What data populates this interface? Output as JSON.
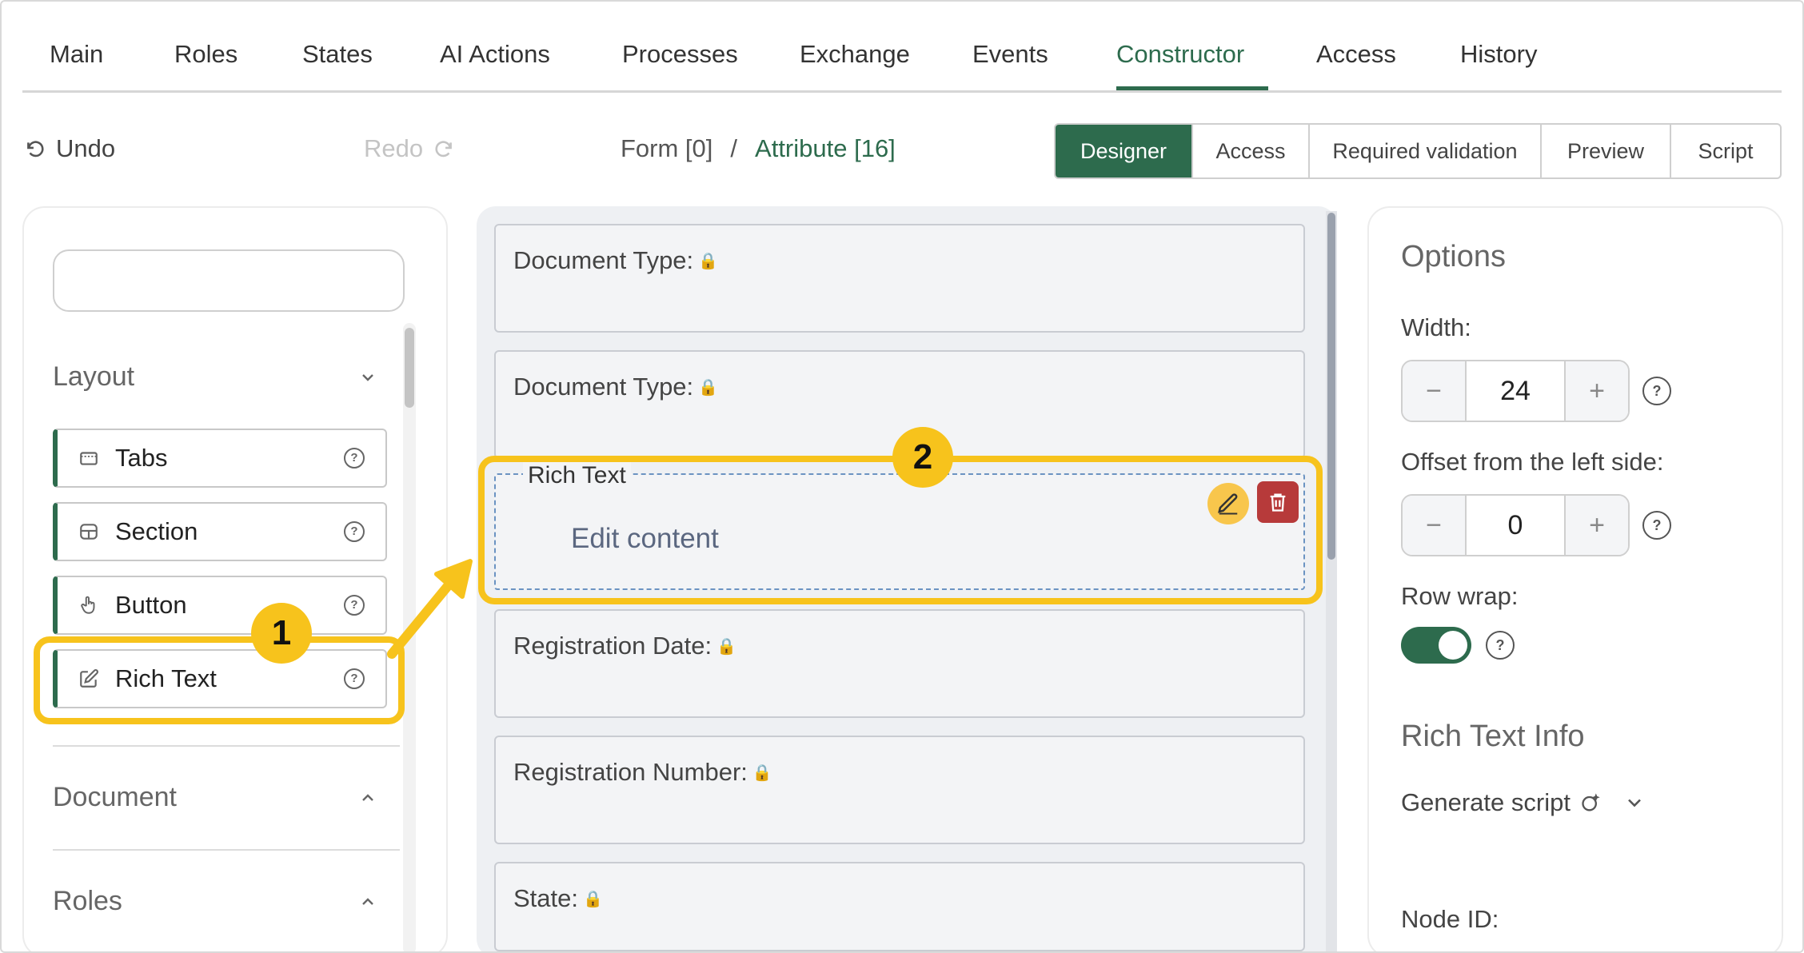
{
  "top_tabs": [
    {
      "label": "Main"
    },
    {
      "label": "Roles"
    },
    {
      "label": "States"
    },
    {
      "label": "AI Actions"
    },
    {
      "label": "Processes"
    },
    {
      "label": "Exchange"
    },
    {
      "label": "Events"
    },
    {
      "label": "Constructor",
      "active": true
    },
    {
      "label": "Access"
    },
    {
      "label": "History"
    }
  ],
  "toolbar": {
    "undo_label": "Undo",
    "redo_label": "Redo",
    "breadcrumb": {
      "form": "Form [0]",
      "separator": "/",
      "attribute": "Attribute [16]"
    },
    "modes": [
      "Designer",
      "Access",
      "Required validation",
      "Preview",
      "Script"
    ],
    "active_mode": "Designer"
  },
  "left_panel": {
    "search_placeholder": "",
    "groups": {
      "layout": "Layout",
      "document": "Document",
      "roles": "Roles"
    },
    "items": [
      {
        "label": "Tabs",
        "icon": "tabs-icon"
      },
      {
        "label": "Section",
        "icon": "section-icon"
      },
      {
        "label": "Button",
        "icon": "pointer-hand-icon"
      },
      {
        "label": "Rich Text",
        "icon": "edit-icon"
      }
    ]
  },
  "canvas": {
    "fields": [
      {
        "label": "Document Type:"
      },
      {
        "label": "Document Type:"
      },
      {
        "label": "Registration Date:"
      },
      {
        "label": "Registration Number:"
      },
      {
        "label": "State:"
      }
    ],
    "rich_text": {
      "legend": "Rich Text",
      "placeholder": "Edit content"
    }
  },
  "callouts": {
    "step1": "1",
    "step2": "2"
  },
  "right_panel": {
    "title": "Options",
    "width_label": "Width:",
    "width_value": "24",
    "offset_label": "Offset from the left side:",
    "offset_value": "0",
    "row_wrap_label": "Row wrap:",
    "row_wrap_on": true,
    "info_title": "Rich Text Info",
    "generate_script_label": "Generate script",
    "node_id_label": "Node ID:"
  },
  "colors": {
    "accent": "#2d6b4d",
    "highlight": "#f7c31c",
    "delete": "#b73a3a",
    "edit": "#f8c64c"
  }
}
